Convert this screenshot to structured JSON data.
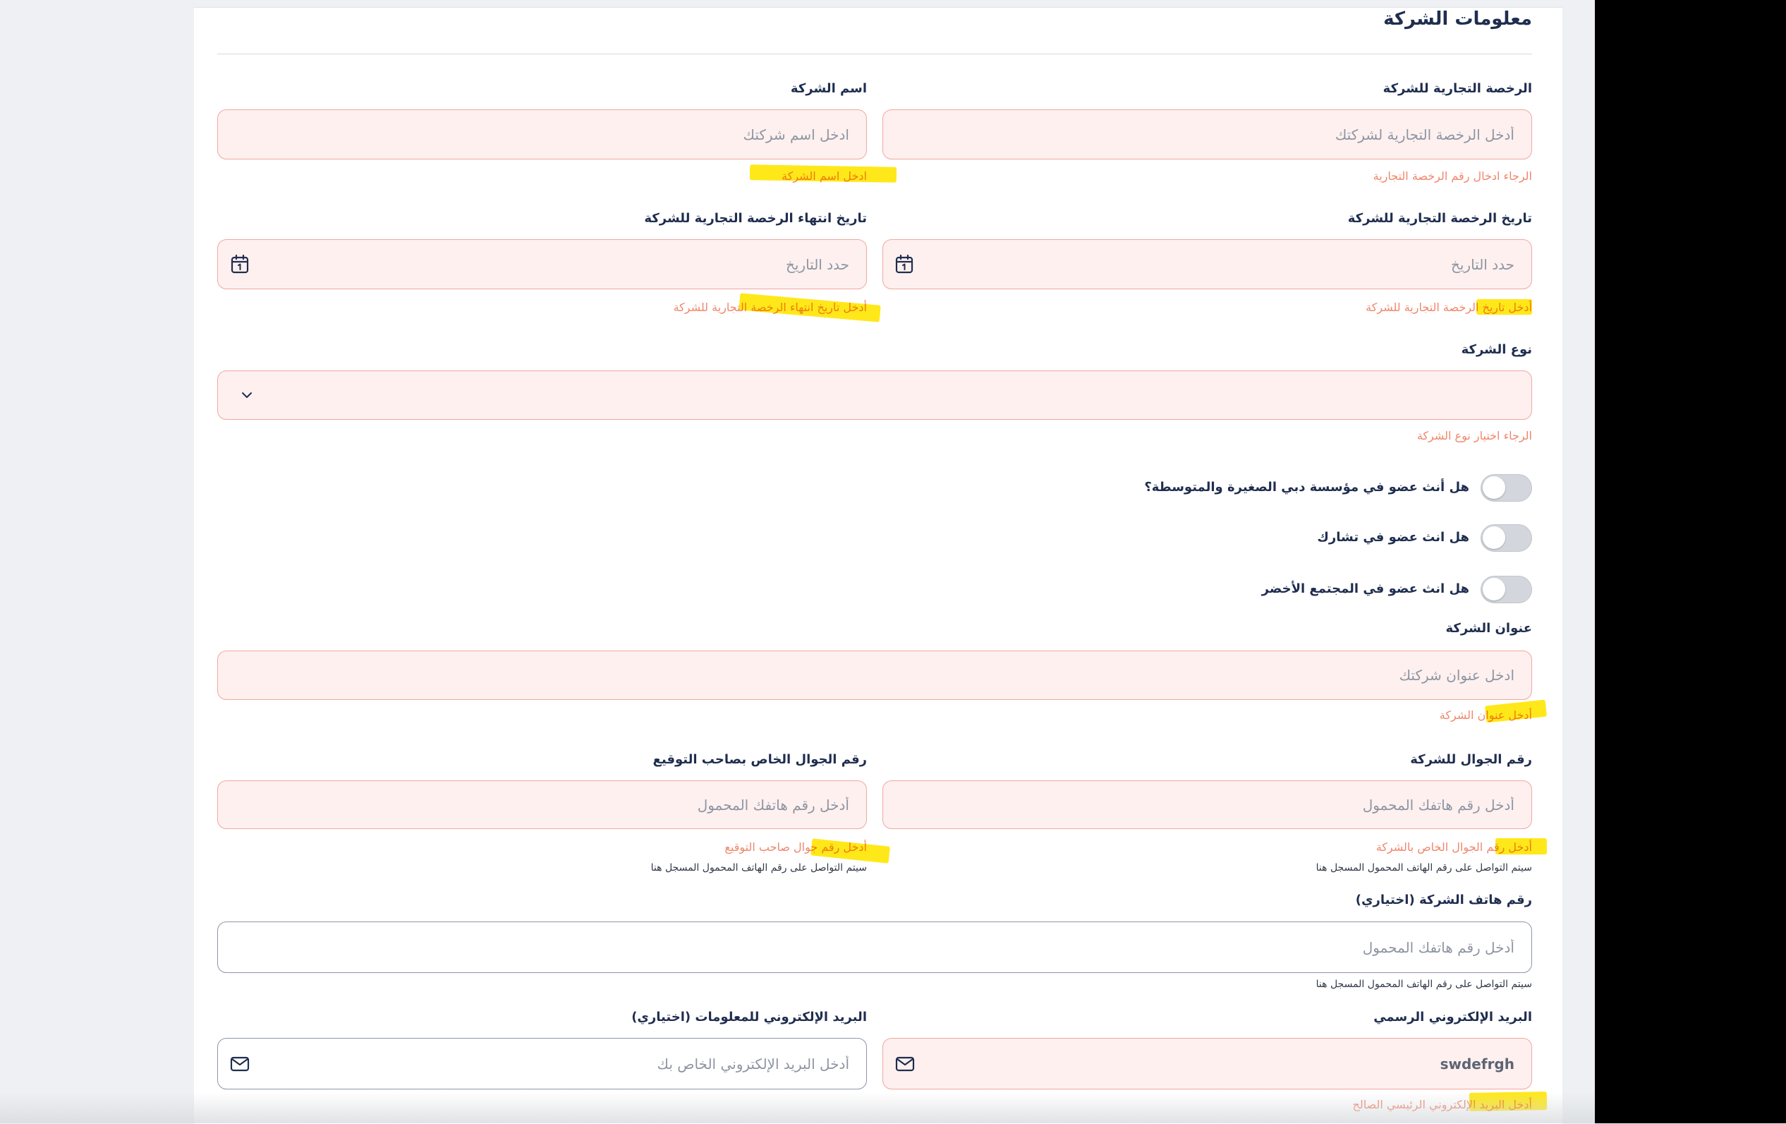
{
  "section_title": "معلومات الشركة",
  "form": {
    "trade_license": {
      "label": "الرخصة التجارية للشركة",
      "placeholder": "أدخل الرخصة التجارية لشركتك",
      "error": "الرجاء ادخال رقم الرخصة التجارية"
    },
    "company_name": {
      "label": "اسم الشركة",
      "placeholder": "ادخل اسم شركتك",
      "error": "ادخل اسم الشركة"
    },
    "license_date": {
      "label": "تاريخ الرخصة التجارية للشركة",
      "placeholder": "حدد التاريخ",
      "error": "أدخل تاريخ الرخصة التجارية للشركة"
    },
    "license_expiry": {
      "label": "تاريخ انتهاء الرخصة التجارية للشركة",
      "placeholder": "حدد التاريخ",
      "error": "أدخل تاريخ انتهاء الرخصة التجارية للشركة"
    },
    "company_type": {
      "label": "نوع الشركة",
      "error": "الرجاء اختيار نوع الشركة"
    },
    "membership_toggles": [
      {
        "label": "هل أنث عضو في مؤسسة دبي الصغيرة والمتوسطة؟",
        "checked": false
      },
      {
        "label": "هل انث عضو في تشارك",
        "checked": false
      },
      {
        "label": "هل انث عضو في المجتمع الأخضر",
        "checked": false
      }
    ],
    "address": {
      "label": "عنوان الشركة",
      "placeholder": "ادخل عنوان شركتك",
      "error": "أدخل عنوان الشركة"
    },
    "company_mobile": {
      "label": "رقم الجوال للشركة",
      "placeholder": "أدخل رقم هاتفك المحمول",
      "error": "أدخل رقم الجوال الخاص بالشركة",
      "hint": "سيتم التواصل على رقم الهاتف المحمول المسجل هنا"
    },
    "signatory_mobile": {
      "label": "رقم الجوال الخاص بصاحب التوقيع",
      "placeholder": "أدخل رقم هاتفك المحمول",
      "error": "أدخل رقم جوال صاحب التوقيع",
      "hint": "سيتم التواصل على رقم الهاتف المحمول المسجل هنا"
    },
    "company_phone": {
      "label": "رقم هاتف الشركة (اختياري)",
      "placeholder": "أدخل رقم هاتفك المحمول",
      "hint": "سيتم التواصل على رقم الهاتف المحمول المسجل هنا"
    },
    "official_email": {
      "label": "البريد الإلكتروني الرسمي",
      "value": "swdefrgh",
      "error": "أدخل البريد الإلكتروني الرئيسي الصالح"
    },
    "info_email": {
      "label": "البريد الإلكتروني للمعلومات (اختياري)",
      "placeholder": "أدخل البريد الإلكتروني الخاص بك"
    }
  },
  "icons": {
    "date_picker": "calendar-icon",
    "dropdown": "chevron-down-icon",
    "email": "envelope-icon"
  },
  "colors": {
    "error": "#f0866a",
    "error_bg": "#fdf0ef",
    "error_border": "#f2a7a0",
    "label": "#1f2d4f",
    "highlight": "#ffe600"
  }
}
